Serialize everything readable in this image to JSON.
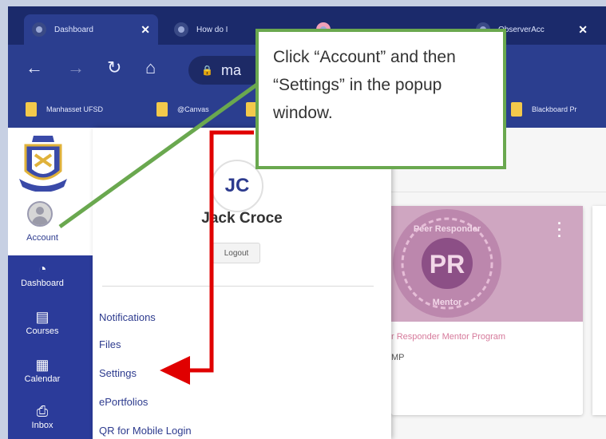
{
  "browser": {
    "tabs": [
      {
        "title": "Dashboard",
        "active": true
      },
      {
        "title": "How do I",
        "active": false
      },
      {
        "title": "",
        "active": false
      },
      {
        "title": "ObserverAcc",
        "active": false
      }
    ],
    "omnibox_text": "ma",
    "bookmarks": [
      "Manhasset UFSD",
      "@Canvas",
      "Blackboard Pr"
    ]
  },
  "global_nav": {
    "account_label": "Account",
    "items": [
      {
        "label": "Dashboard",
        "icon": "dashboard-icon"
      },
      {
        "label": "Courses",
        "icon": "courses-icon"
      },
      {
        "label": "Calendar",
        "icon": "calendar-icon"
      },
      {
        "label": "Inbox",
        "icon": "inbox-icon"
      }
    ]
  },
  "account_tray": {
    "initials": "JC",
    "name": "Jack Croce",
    "logout_label": "Logout",
    "links": [
      "Notifications",
      "Files",
      "Settings",
      "ePortfolios",
      "QR for Mobile Login"
    ]
  },
  "dashboard": {
    "card": {
      "badge_text": "PR",
      "badge_top": "Peer Responder",
      "badge_bottom": "Mentor",
      "title": "r Responder Mentor Program",
      "subtitle": "MP"
    }
  },
  "callout": {
    "text": "Click “Account” and then “Settings” in the popup window."
  },
  "colors": {
    "canvas_nav": "#2b3b9a",
    "browser_chrome": "#2b3e8f",
    "callout_border": "#6aa84f",
    "arrow": "#e00000",
    "link": "#2d3b8e"
  }
}
